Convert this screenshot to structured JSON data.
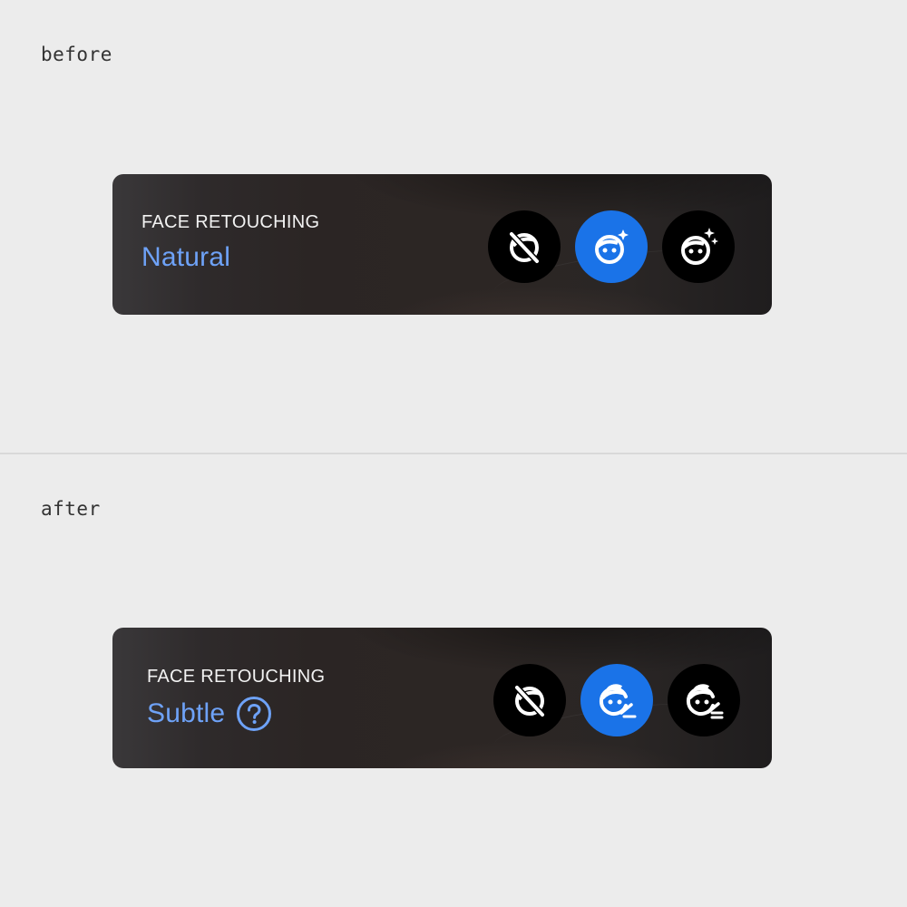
{
  "before": {
    "label": "before",
    "panel": {
      "title": "FACE RETOUCHING",
      "value": "Natural",
      "options": [
        {
          "icon": "face-retouching-off-icon",
          "selected": false
        },
        {
          "icon": "face-retouching-natural-icon",
          "selected": true
        },
        {
          "icon": "face-retouching-strong-icon",
          "selected": false
        }
      ]
    }
  },
  "after": {
    "label": "after",
    "panel": {
      "title": "FACE RETOUCHING",
      "value": "Subtle",
      "help_icon": "help-circle-icon",
      "options": [
        {
          "icon": "face-retouching-off-icon",
          "selected": false
        },
        {
          "icon": "face-retouching-subtle-icon",
          "selected": true
        },
        {
          "icon": "face-retouching-strong-edit-icon",
          "selected": false
        }
      ]
    }
  },
  "colors": {
    "page_bg": "#ececec",
    "accent": "#1a73e8",
    "value_text": "#6ea2f7",
    "option_bg": "#000000"
  }
}
